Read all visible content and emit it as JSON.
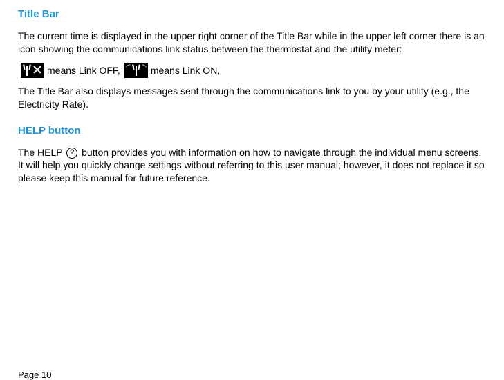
{
  "section1": {
    "heading": "Title Bar",
    "p1": "The current time is displayed in the upper right corner of the Title Bar while in the upper left corner there is an icon showing the communications link status between the thermostat and the utility meter:",
    "linkoff_text": "means Link OFF,",
    "linkon_text": "means Link ON,",
    "p2": "The Title Bar also displays messages sent through the communications link to you by your utility (e.g., the Electricity Rate)."
  },
  "section2": {
    "heading": "HELP button",
    "p1_a": "The HELP",
    "p1_b": "button provides you with information on how to navigate through the individual menu screens. It will help you quickly change settings without referring to this user manual; however, it does not replace it so please keep this manual for future reference."
  },
  "help_glyph": "?",
  "page": "Page 10"
}
